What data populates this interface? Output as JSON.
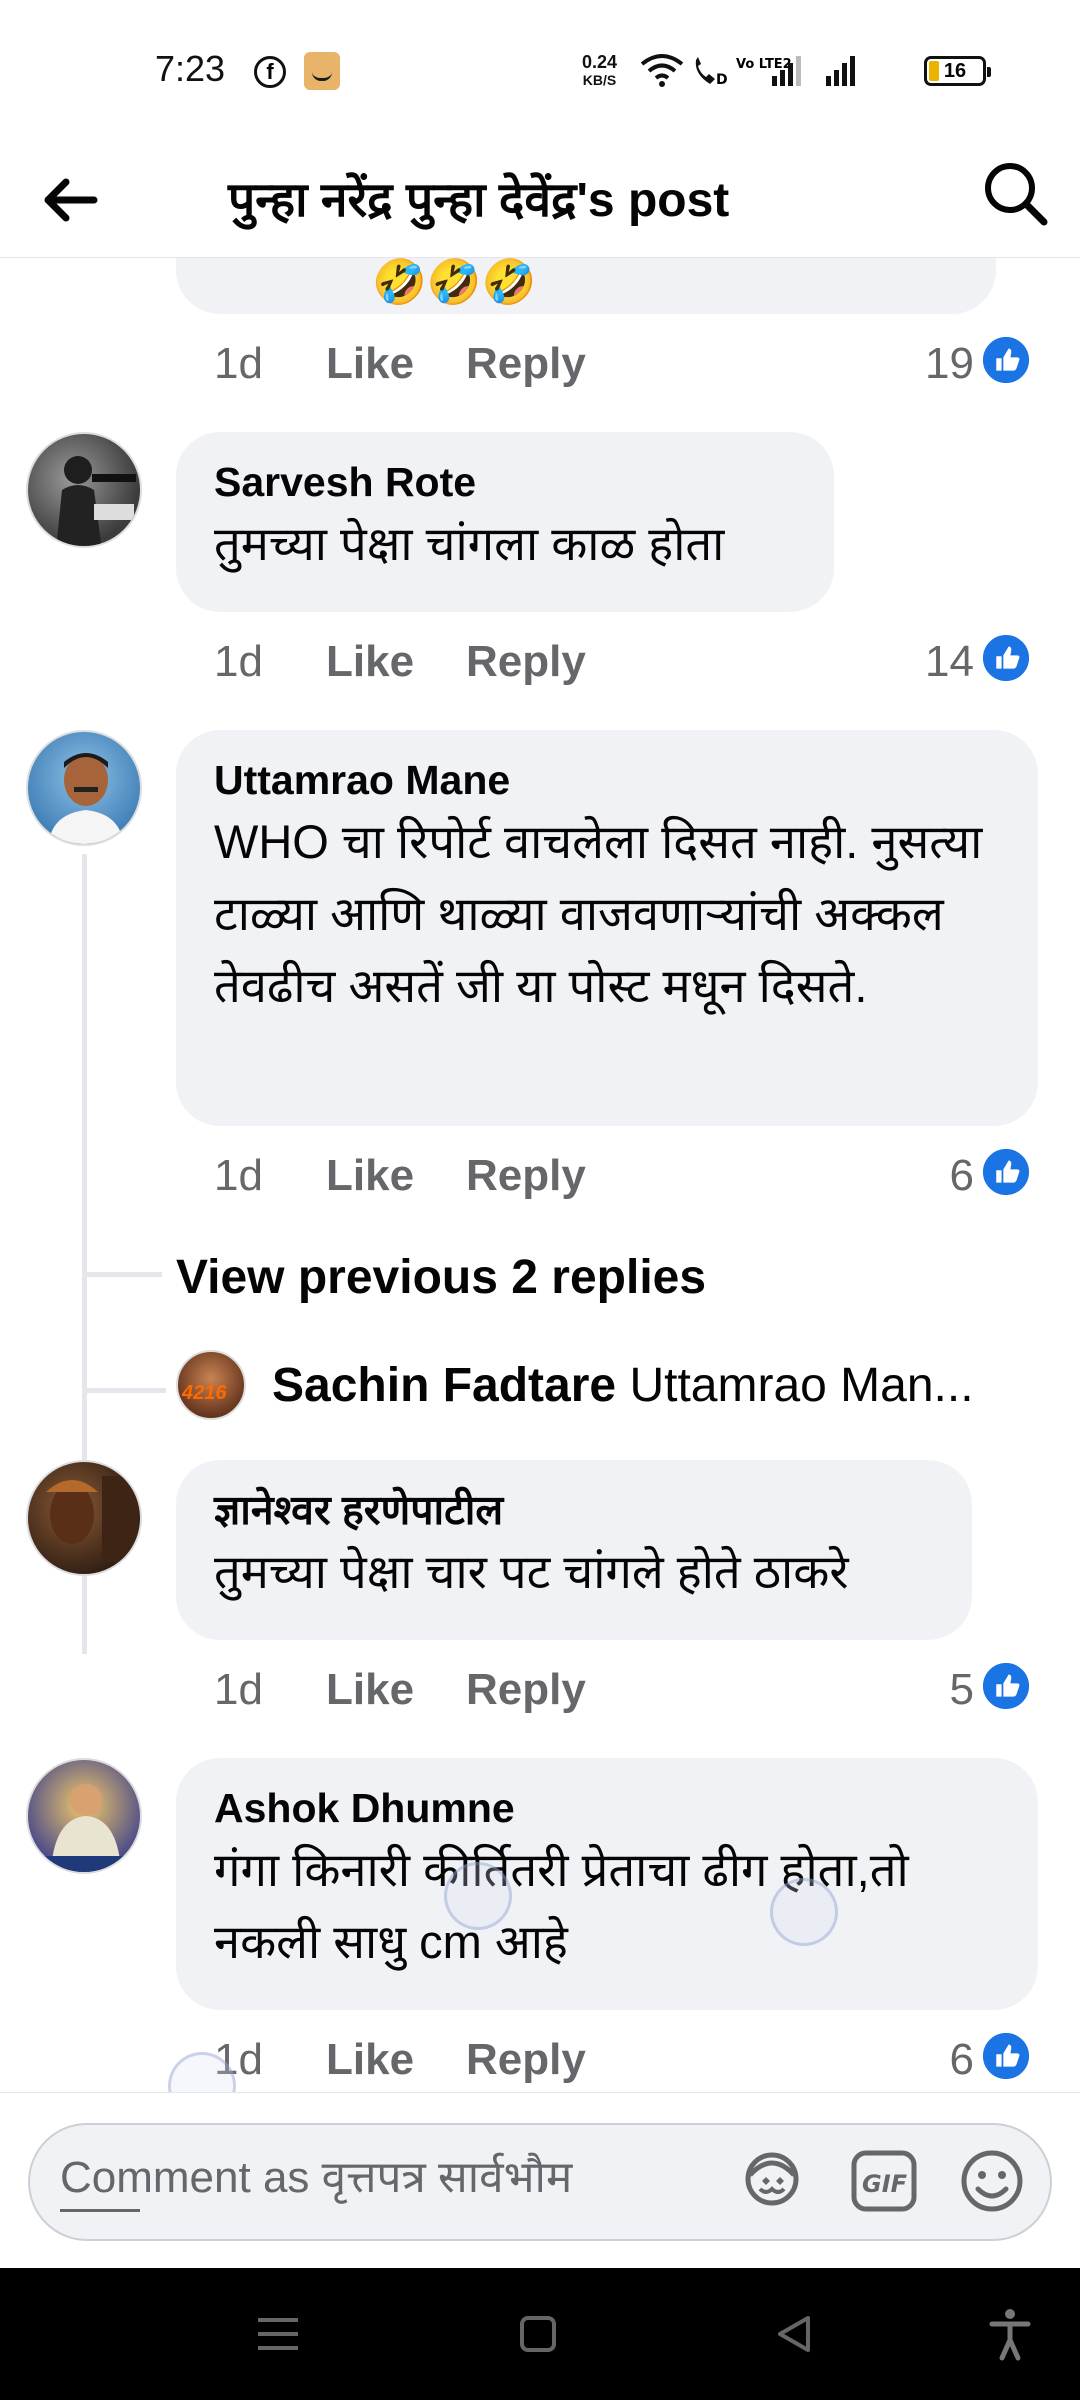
{
  "status_bar": {
    "time": "7:23",
    "net_speed_value": "0.24",
    "net_speed_unit": "KB/S",
    "volte_label": "Vo LTE2",
    "battery": "16"
  },
  "header": {
    "title": "पुन्हा नरेंद्र पुन्हा देवेंद्र's post"
  },
  "comments": [
    {
      "author": "",
      "text": "",
      "time": "1d",
      "like": "Like",
      "reply": "Reply",
      "reactions": "19"
    },
    {
      "author": "Sarvesh Rote",
      "text": "तुमच्या पेक्षा चांगला काळ होता",
      "time": "1d",
      "like": "Like",
      "reply": "Reply",
      "reactions": "14"
    },
    {
      "author": "Uttamrao Mane",
      "text": "WHO चा रिपोर्ट वाचलेला दिसत नाही. नुसत्या टाळ्या आणि थाळ्या वाजवणाऱ्यांची अक्कल तेवढीच असतें जी या पोस्ट मधून दिसते.",
      "time": "1d",
      "like": "Like",
      "reply": "Reply",
      "reactions": "6"
    },
    {
      "author": "ज्ञानेश्वर हरणेपाटील",
      "text": "तुमच्या पेक्षा चार पट चांगले होते ठाकरे",
      "time": "1d",
      "like": "Like",
      "reply": "Reply",
      "reactions": "5"
    },
    {
      "author": "Ashok Dhumne",
      "text": "गंगा किनारी कीर्तितरी प्रेताचा ढीग होता,तो नकली साधु cm आहे",
      "time": "1d",
      "like": "Like",
      "reply": "Reply",
      "reactions": "6"
    }
  ],
  "thread": {
    "view_previous": "View previous 2 replies",
    "reply_author": "Sachin Fadtare",
    "reply_preview": "Uttamrao Man..."
  },
  "composer": {
    "placeholder": "Comment as वृत्तपत्र सार्वभौम"
  },
  "colors": {
    "facebook_blue": "#1b74e4",
    "bubble_gray": "#f0f2f5",
    "secondary_text": "#65676b"
  },
  "icons": [
    "back-arrow-icon",
    "search-icon",
    "like-thumb-icon",
    "avatar-sticker-icon",
    "gif-icon",
    "emoji-icon",
    "menu-icon",
    "home-square-icon",
    "back-triangle-icon",
    "accessibility-icon"
  ]
}
